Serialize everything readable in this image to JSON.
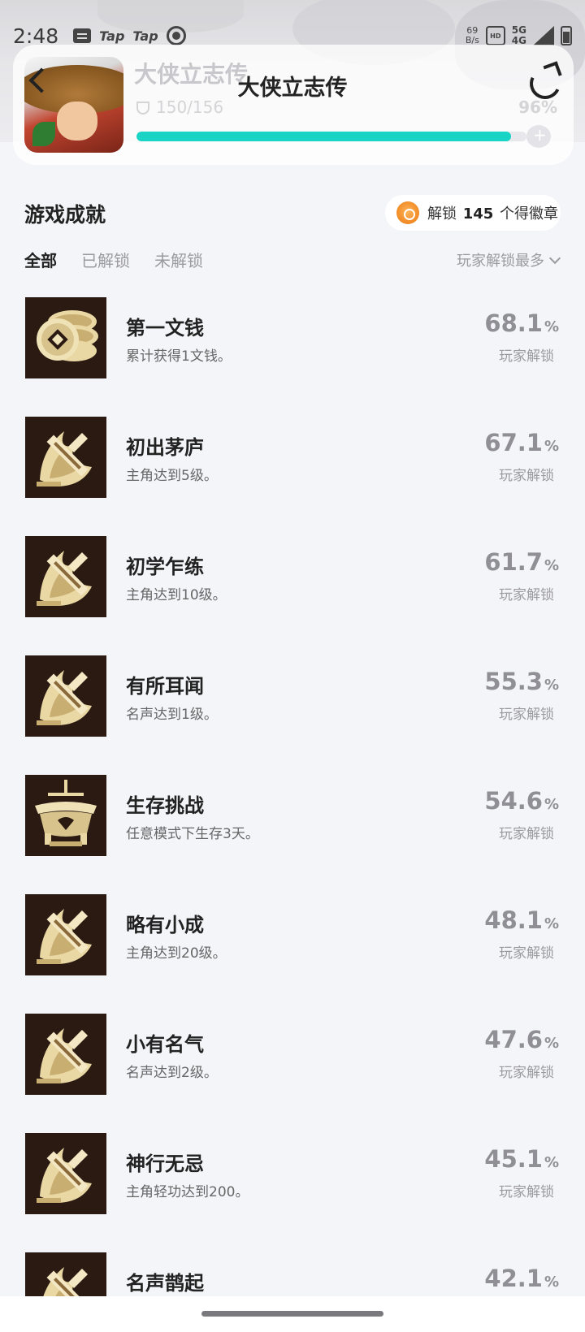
{
  "status_bar": {
    "time": "2:48",
    "app_badges": [
      "Tap",
      "Tap"
    ],
    "speed_value": "69",
    "speed_unit": "B/s",
    "hd": "HD",
    "network_top": "5G",
    "network_bottom": "4G"
  },
  "header": {
    "title": "大侠立志传",
    "ghost_title": "大侠立志传",
    "achievement_count": "150/156",
    "completion_pct": "96%",
    "progress": 0.96
  },
  "section": {
    "title": "游戏成就",
    "badge_prefix": "解锁",
    "badge_count": "145",
    "badge_suffix": "个得徽章"
  },
  "tabs": [
    {
      "label": "全部",
      "active": true
    },
    {
      "label": "已解锁",
      "active": false
    },
    {
      "label": "未解锁",
      "active": false
    }
  ],
  "sort_label": "玩家解锁最多",
  "achievements": [
    {
      "name": "第一文钱",
      "desc": "累计获得1文钱。",
      "pct": "68.1",
      "unit": "%",
      "sub": "玩家解锁",
      "icon": "coins-icon"
    },
    {
      "name": "初出茅庐",
      "desc": "主角达到5级。",
      "pct": "67.1",
      "unit": "%",
      "sub": "玩家解锁",
      "icon": "sword-icon"
    },
    {
      "name": "初学乍练",
      "desc": "主角达到10级。",
      "pct": "61.7",
      "unit": "%",
      "sub": "玩家解锁",
      "icon": "sword-icon"
    },
    {
      "name": "有所耳闻",
      "desc": "名声达到1级。",
      "pct": "55.3",
      "unit": "%",
      "sub": "玩家解锁",
      "icon": "sword-icon"
    },
    {
      "name": "生存挑战",
      "desc": "任意模式下生存3天。",
      "pct": "54.6",
      "unit": "%",
      "sub": "玩家解锁",
      "icon": "cauldron-icon"
    },
    {
      "name": "略有小成",
      "desc": "主角达到20级。",
      "pct": "48.1",
      "unit": "%",
      "sub": "玩家解锁",
      "icon": "sword-icon"
    },
    {
      "name": "小有名气",
      "desc": "名声达到2级。",
      "pct": "47.6",
      "unit": "%",
      "sub": "玩家解锁",
      "icon": "sword-icon"
    },
    {
      "name": "神行无忌",
      "desc": "主角轻功达到200。",
      "pct": "45.1",
      "unit": "%",
      "sub": "玩家解锁",
      "icon": "sword-icon"
    },
    {
      "name": "名声鹊起",
      "desc": "",
      "pct": "42.1",
      "unit": "%",
      "sub": "",
      "icon": "sword-icon"
    }
  ]
}
